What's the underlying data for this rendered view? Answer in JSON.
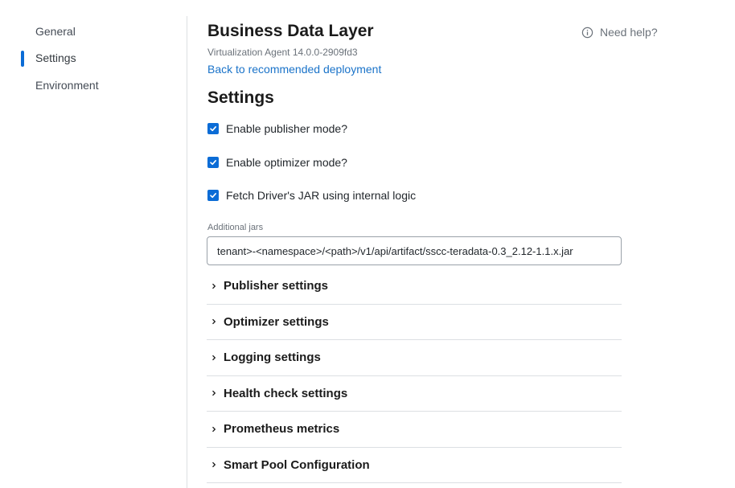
{
  "sidebar": {
    "items": [
      {
        "label": "General",
        "active": false
      },
      {
        "label": "Settings",
        "active": true
      },
      {
        "label": "Environment",
        "active": false
      }
    ]
  },
  "header": {
    "title": "Business Data Layer",
    "subtitle": "Virtualization Agent 14.0.0-2909fd3",
    "back_link": "Back to recommended deployment",
    "help": "Need help?"
  },
  "settings": {
    "title": "Settings",
    "checkboxes": [
      {
        "label": "Enable publisher mode?",
        "checked": true
      },
      {
        "label": "Enable optimizer mode?",
        "checked": true
      },
      {
        "label": "Fetch Driver's JAR using internal logic",
        "checked": true
      }
    ],
    "additional_jars": {
      "label": "Additional jars",
      "value": "tenant>-<namespace>/<path>/v1/api/artifact/sscc-teradata-0.3_2.12-1.1.x.jar"
    },
    "sections": [
      {
        "label": "Publisher settings"
      },
      {
        "label": "Optimizer settings"
      },
      {
        "label": "Logging settings"
      },
      {
        "label": "Health check settings"
      },
      {
        "label": "Prometheus metrics"
      },
      {
        "label": "Smart Pool Configuration"
      }
    ]
  },
  "colors": {
    "accent": "#0b6cd6",
    "link": "#1a73c9",
    "divider": "#dcdfe3"
  }
}
